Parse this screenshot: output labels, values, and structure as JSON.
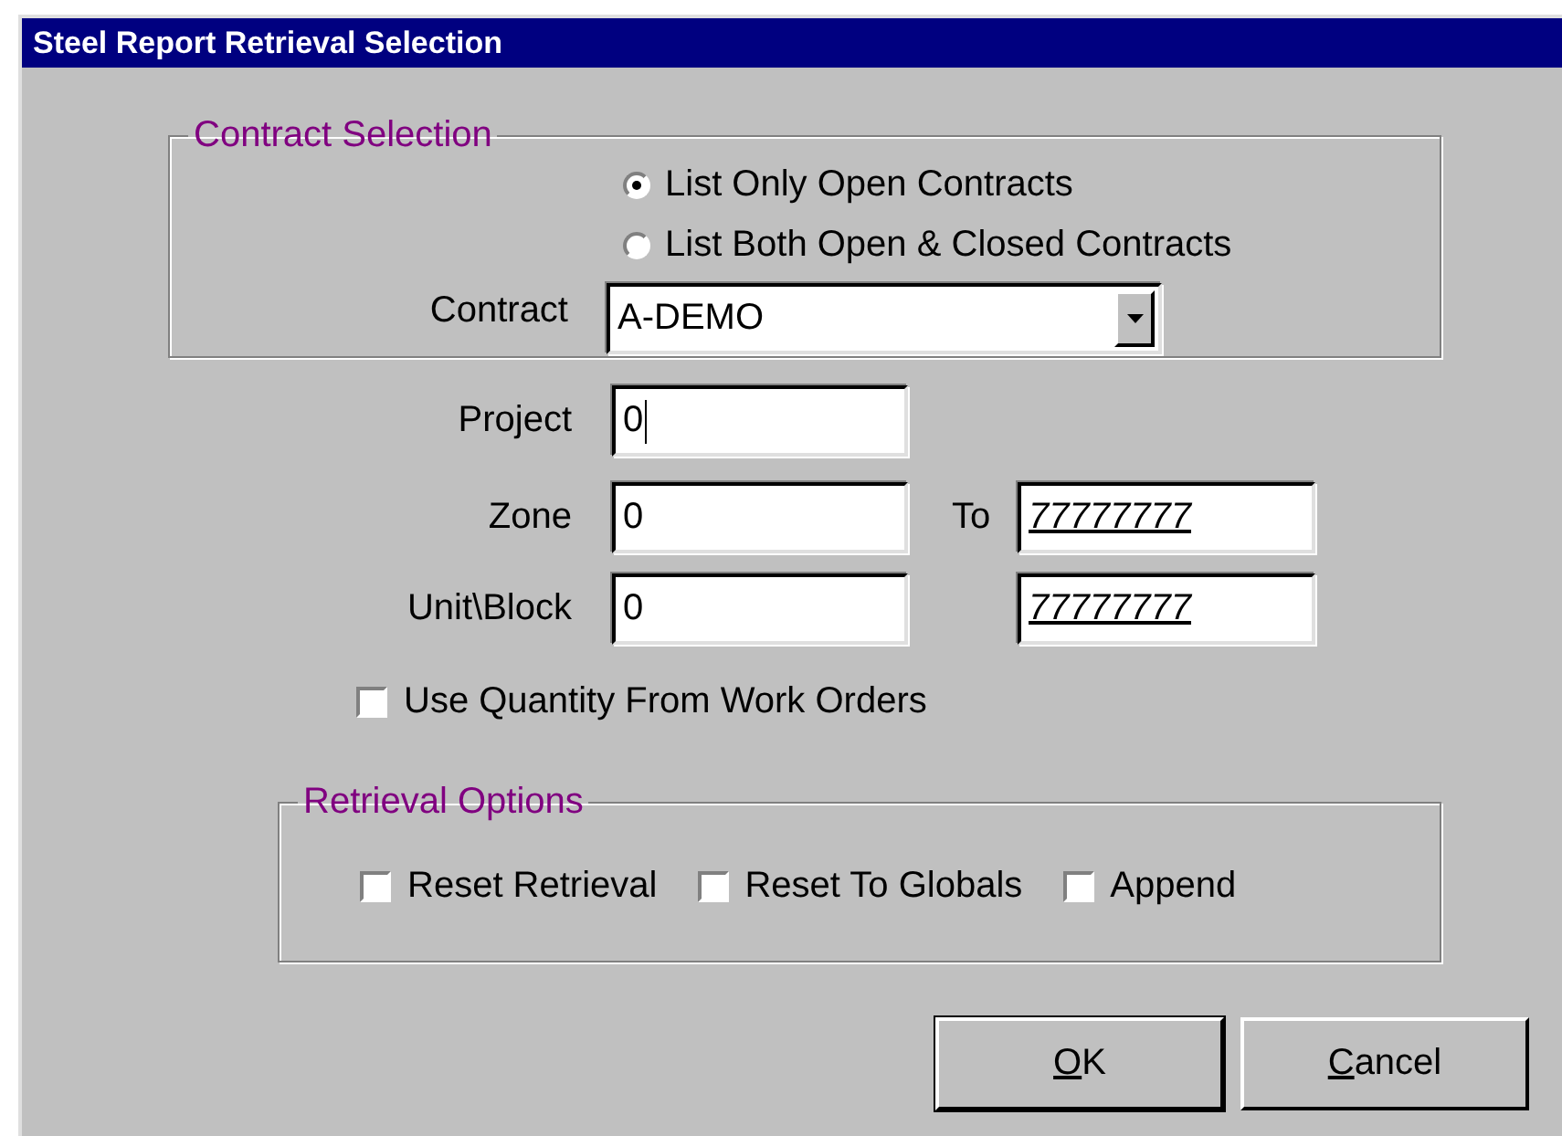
{
  "window": {
    "title": "Steel Report Retrieval Selection"
  },
  "contract_selection": {
    "title": "Contract Selection",
    "options": [
      {
        "label": "List Only Open Contracts",
        "selected": true
      },
      {
        "label": "List Both Open & Closed Contracts",
        "selected": false
      }
    ],
    "contract": {
      "label": "Contract",
      "value": "A-DEMO"
    }
  },
  "project": {
    "label": "Project",
    "value": "0",
    "focused": true
  },
  "zone": {
    "label": "Zone",
    "value": "0",
    "to_label": "To",
    "to_value": "77777777"
  },
  "unit_block": {
    "label": "Unit\\Block",
    "value": "0",
    "to_value": "77777777"
  },
  "use_quantity": {
    "label": "Use Quantity From Work Orders",
    "checked": false
  },
  "retrieval_options": {
    "title": "Retrieval Options",
    "items": [
      {
        "label": "Reset Retrieval",
        "checked": false
      },
      {
        "label": "Reset To Globals",
        "checked": false
      },
      {
        "label": "Append",
        "checked": false
      }
    ]
  },
  "buttons": [
    {
      "label": "OK",
      "underline_first": true
    },
    {
      "label": "Cancel",
      "underline_first": true
    }
  ]
}
